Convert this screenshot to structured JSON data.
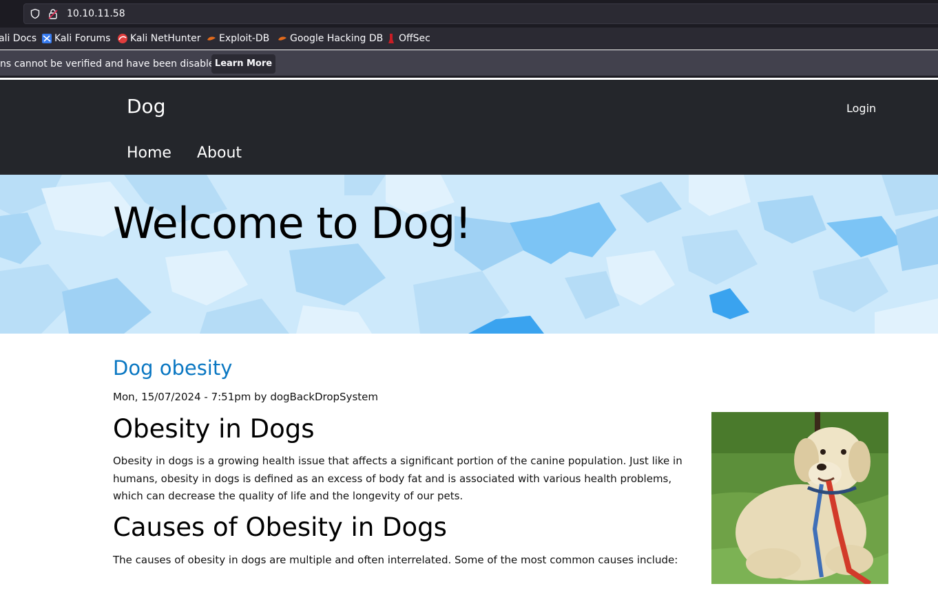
{
  "browser": {
    "url": "10.10.11.58",
    "bookmarks": [
      {
        "label": "ali Docs",
        "icon": "none"
      },
      {
        "label": "Kali Forums",
        "icon": "kali-forums-icon"
      },
      {
        "label": "Kali NetHunter",
        "icon": "kali-nethunter-icon"
      },
      {
        "label": "Exploit-DB",
        "icon": "exploit-db-icon"
      },
      {
        "label": "Google Hacking DB",
        "icon": "ghdb-icon"
      },
      {
        "label": "OffSec",
        "icon": "offsec-icon"
      }
    ],
    "notice": {
      "message": "ns cannot be verified and have been disabled.",
      "button": "Learn More"
    }
  },
  "site": {
    "name": "Dog",
    "login": "Login",
    "nav": [
      "Home",
      "About"
    ]
  },
  "hero": {
    "title": "Welcome to Dog!"
  },
  "article": {
    "title": "Dog obesity",
    "meta": "Mon, 15/07/2024 - 7:51pm by dogBackDropSystem",
    "heading1": "Obesity in Dogs",
    "para1": "Obesity in dogs is a growing health issue that affects a significant portion of the canine population. Just like in humans, obesity in dogs is defined as an excess of body fat and is associated with various health problems, which can decrease the quality of life and the longevity of our pets.",
    "heading2": "Causes of Obesity in Dogs",
    "para2": "The causes of obesity in dogs are multiple and often interrelated. Some of the most common causes include:"
  },
  "colors": {
    "header_bg": "#24262b",
    "link": "#0a77c2",
    "hero_light": "#cde9fb",
    "hero_dark": "#7cc4f5"
  }
}
